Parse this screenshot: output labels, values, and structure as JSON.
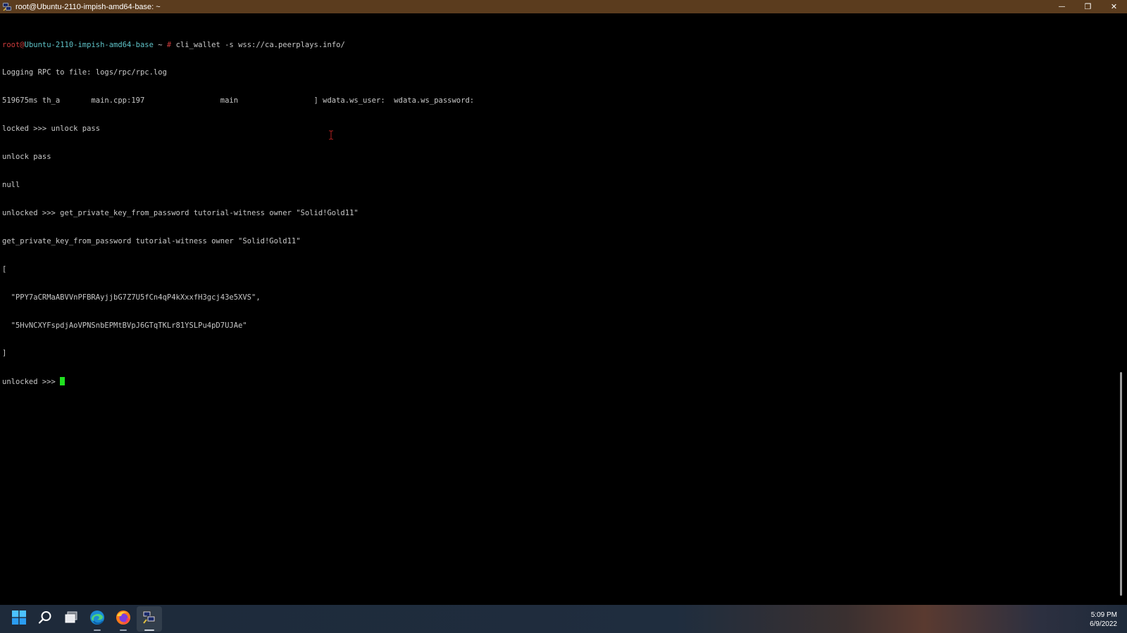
{
  "window": {
    "title": "root@Ubuntu-2110-impish-amd64-base: ~",
    "controls": {
      "minimize": "—",
      "restore": "❐",
      "close": "✕"
    },
    "icon": "putty-icon"
  },
  "terminal": {
    "prompt": {
      "user": "root",
      "at": "@",
      "host": "Ubuntu-2110-impish-amd64-base",
      "path": " ~ ",
      "symbol": "#",
      "command": " cli_wallet -s wss://ca.peerplays.info/"
    },
    "lines": [
      "Logging RPC to file: logs/rpc/rpc.log",
      "519675ms th_a       main.cpp:197                 main                 ] wdata.ws_user:  wdata.ws_password:",
      "locked >>> unlock pass",
      "unlock pass",
      "null",
      "unlocked >>> get_private_key_from_password tutorial-witness owner \"Solid!Gold11\"",
      "get_private_key_from_password tutorial-witness owner \"Solid!Gold11\"",
      "[",
      "  \"PPY7aCRMaABVVnPFBRAyjjbG7Z7U5fCn4qP4kXxxfH3gcj43e5XVS\",",
      "  \"5HvNCXYFspdjAoVPNSnbEPMtBVpJ6GTqTKLr81YSLPu4pD7UJAe\"",
      "]"
    ],
    "current_prompt": "unlocked >>> "
  },
  "taskbar": {
    "items": [
      {
        "name": "start-icon"
      },
      {
        "name": "search-icon"
      },
      {
        "name": "task-view-icon"
      },
      {
        "name": "edge-icon"
      },
      {
        "name": "firefox-icon"
      },
      {
        "name": "putty-icon"
      }
    ],
    "clock": {
      "time": "5:09 PM",
      "date": "6/9/2022"
    }
  },
  "colors": {
    "titlebar": "#5b3c1e",
    "prompt_user": "#cc3b3b",
    "prompt_host": "#5fc3c8",
    "cursor": "#20e020",
    "text": "#c8c8c8"
  }
}
